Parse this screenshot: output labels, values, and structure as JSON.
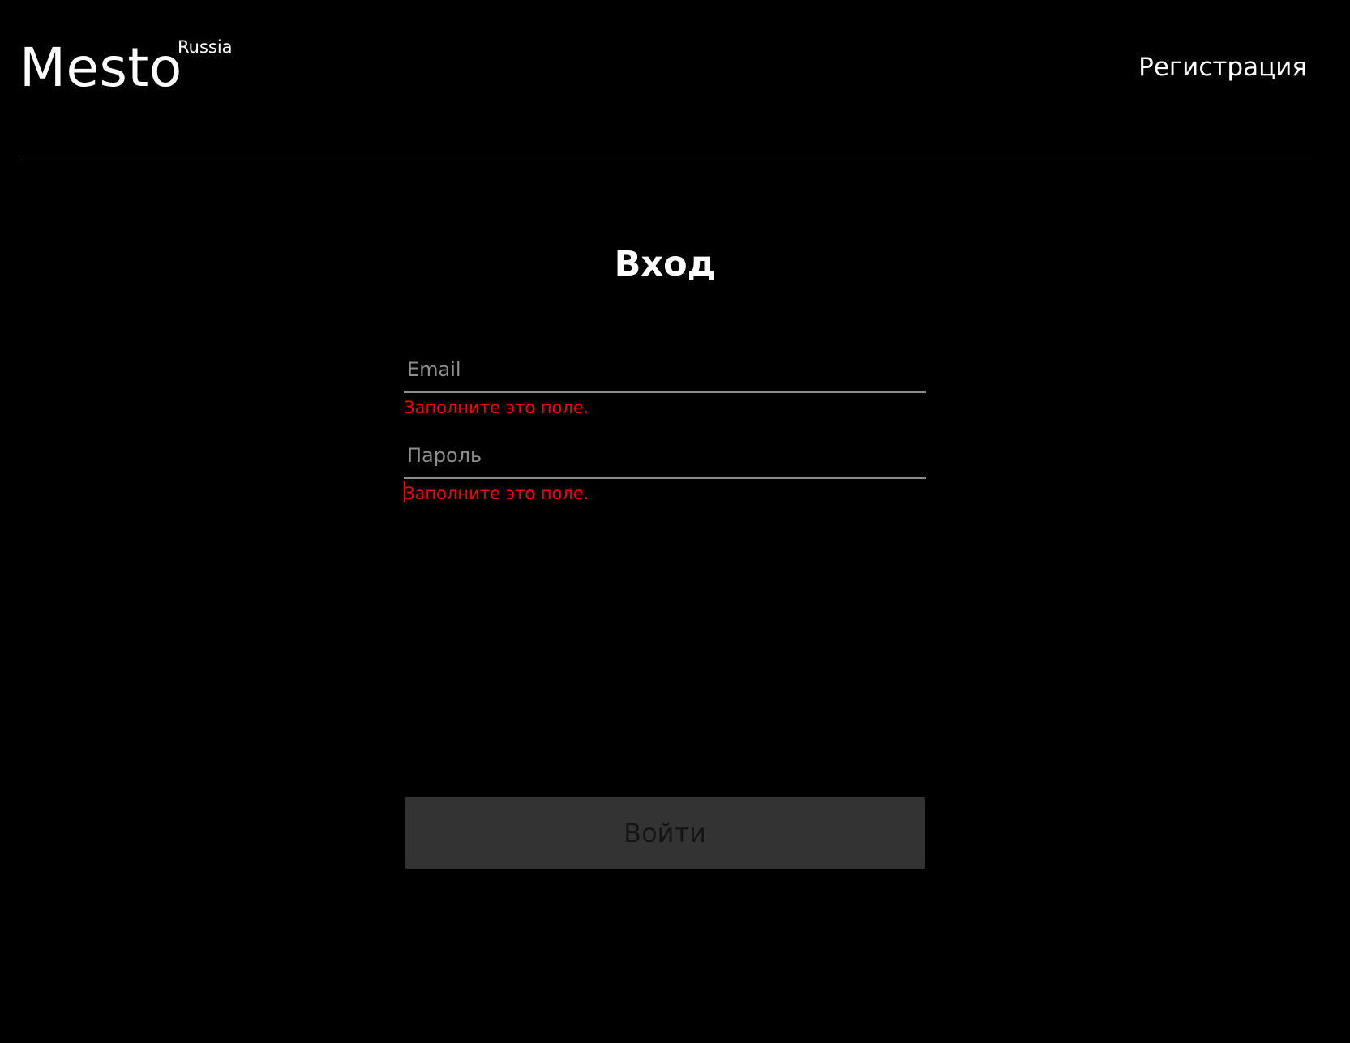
{
  "header": {
    "logo_text": "Mesto",
    "logo_superscript": "Russia",
    "nav_link": "Регистрация"
  },
  "form": {
    "title": "Вход",
    "email": {
      "value": "",
      "placeholder": "Email",
      "error": "Заполните это поле."
    },
    "password": {
      "value": "",
      "placeholder": "Пароль",
      "error": "Заполните это поле."
    },
    "submit_label": "Войти"
  },
  "colors": {
    "background": "#000000",
    "text": "#ffffff",
    "error": "#ff0000",
    "button_disabled": "#333333"
  }
}
